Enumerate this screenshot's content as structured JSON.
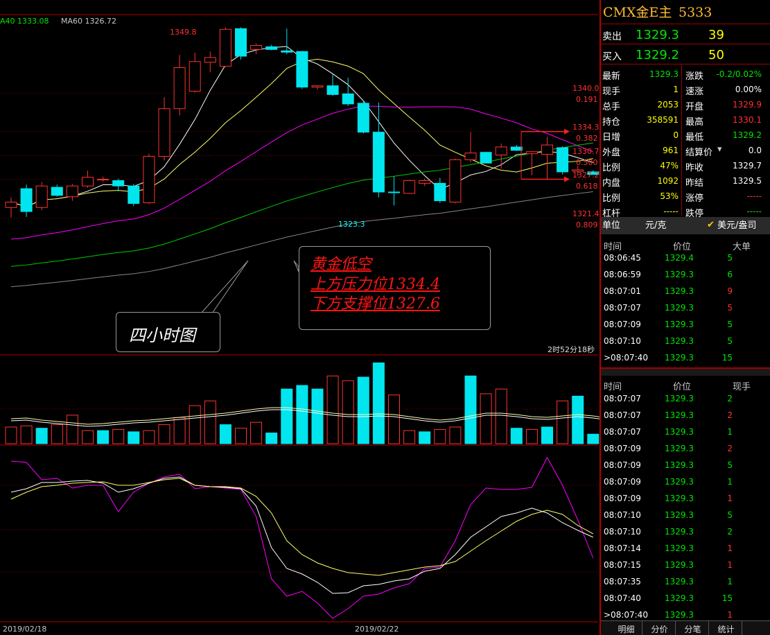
{
  "ma_legend": {
    "ma40": "A40 1333.08",
    "ma60": "MA60 1326.72"
  },
  "price_labels": {
    "high": "1349.8",
    "low": "1323.3",
    "levels": [
      {
        "price": "1340.0",
        "ratio": "0.191",
        "value": 1340.0
      },
      {
        "price": "1334.3",
        "ratio": "0.382",
        "value": 1334.3
      },
      {
        "price": "1330.7",
        "ratio": "0.500",
        "value": 1330.7
      },
      {
        "price": "1327.2",
        "ratio": "0.618",
        "value": 1327.2
      },
      {
        "price": "1321.4",
        "ratio": "0.809",
        "value": 1321.4
      }
    ]
  },
  "annotation": {
    "title": "黄金低空",
    "line1": "上方压力位1334.4",
    "line2": "下方支撑位1327.6"
  },
  "callout": "四小时图",
  "countdown": "2时52分18秒",
  "dates": [
    "2019/02/18",
    "2019/02/22"
  ],
  "colors": {
    "up": "#ff3232",
    "down": "#00e5ee",
    "grid": "#8b0000",
    "accent_red": "#b40000"
  },
  "chart_data": {
    "type": "candlestick",
    "ohlc": [
      {
        "o": 1323.0,
        "h": 1324.5,
        "l": 1321.5,
        "c": 1323.8
      },
      {
        "o": 1325.8,
        "h": 1326.4,
        "l": 1321.6,
        "c": 1322.4
      },
      {
        "o": 1323.0,
        "h": 1326.8,
        "l": 1322.6,
        "c": 1326.2
      },
      {
        "o": 1326.0,
        "h": 1326.4,
        "l": 1324.6,
        "c": 1324.8
      },
      {
        "o": 1324.6,
        "h": 1326.5,
        "l": 1324.0,
        "c": 1326.2
      },
      {
        "o": 1326.2,
        "h": 1328.5,
        "l": 1325.9,
        "c": 1327.5
      },
      {
        "o": 1327.1,
        "h": 1327.6,
        "l": 1326.8,
        "c": 1327.2
      },
      {
        "o": 1327.0,
        "h": 1327.3,
        "l": 1325.4,
        "c": 1326.2
      },
      {
        "o": 1326.2,
        "h": 1326.5,
        "l": 1323.2,
        "c": 1323.6
      },
      {
        "o": 1323.7,
        "h": 1331.0,
        "l": 1323.5,
        "c": 1330.6
      },
      {
        "o": 1330.6,
        "h": 1339.4,
        "l": 1330.0,
        "c": 1337.7
      },
      {
        "o": 1337.7,
        "h": 1345.7,
        "l": 1336.7,
        "c": 1343.8
      },
      {
        "o": 1340.3,
        "h": 1346.0,
        "l": 1340.1,
        "c": 1344.7
      },
      {
        "o": 1344.6,
        "h": 1346.2,
        "l": 1343.1,
        "c": 1345.3
      },
      {
        "o": 1344.0,
        "h": 1349.8,
        "l": 1343.9,
        "c": 1349.5
      },
      {
        "o": 1349.6,
        "h": 1349.8,
        "l": 1345.0,
        "c": 1345.5
      },
      {
        "o": 1346.5,
        "h": 1347.4,
        "l": 1345.8,
        "c": 1347.1
      },
      {
        "o": 1346.9,
        "h": 1347.2,
        "l": 1346.4,
        "c": 1346.5
      },
      {
        "o": 1346.3,
        "h": 1349.6,
        "l": 1345.8,
        "c": 1346.1
      },
      {
        "o": 1346.2,
        "h": 1346.3,
        "l": 1340.6,
        "c": 1340.9
      },
      {
        "o": 1340.9,
        "h": 1341.2,
        "l": 1340.5,
        "c": 1341.1
      },
      {
        "o": 1341.1,
        "h": 1342.8,
        "l": 1339.6,
        "c": 1339.8
      },
      {
        "o": 1339.9,
        "h": 1342.3,
        "l": 1338.1,
        "c": 1338.4
      },
      {
        "o": 1338.5,
        "h": 1338.9,
        "l": 1334.0,
        "c": 1334.2
      },
      {
        "o": 1334.2,
        "h": 1338.6,
        "l": 1324.5,
        "c": 1325.3
      },
      {
        "o": 1325.3,
        "h": 1327.6,
        "l": 1323.3,
        "c": 1325.2
      },
      {
        "o": 1325.1,
        "h": 1327.1,
        "l": 1325.0,
        "c": 1327.0
      },
      {
        "o": 1326.6,
        "h": 1327.3,
        "l": 1326.2,
        "c": 1327.0
      },
      {
        "o": 1326.6,
        "h": 1327.4,
        "l": 1323.7,
        "c": 1324.0
      },
      {
        "o": 1323.8,
        "h": 1330.3,
        "l": 1323.6,
        "c": 1330.1
      },
      {
        "o": 1330.1,
        "h": 1334.2,
        "l": 1329.7,
        "c": 1331.1
      },
      {
        "o": 1331.2,
        "h": 1331.3,
        "l": 1329.6,
        "c": 1329.6
      },
      {
        "o": 1330.8,
        "h": 1332.5,
        "l": 1328.8,
        "c": 1332.0
      },
      {
        "o": 1332.0,
        "h": 1332.3,
        "l": 1331.4,
        "c": 1331.5
      },
      {
        "o": 1331.0,
        "h": 1331.4,
        "l": 1327.8,
        "c": 1331.3
      },
      {
        "o": 1330.9,
        "h": 1333.5,
        "l": 1327.2,
        "c": 1332.3
      },
      {
        "o": 1331.9,
        "h": 1332.1,
        "l": 1327.9,
        "c": 1328.3
      },
      {
        "o": 1328.4,
        "h": 1329.2,
        "l": 1327.7,
        "c": 1328.6
      },
      {
        "o": 1328.3,
        "h": 1328.5,
        "l": 1327.9,
        "c": 1327.9
      }
    ],
    "volume": [
      14,
      15,
      13,
      16,
      24,
      11,
      11,
      12,
      10,
      11,
      16,
      22,
      32,
      36,
      16,
      13,
      18,
      9,
      46,
      49,
      46,
      57,
      53,
      56,
      68,
      41,
      11,
      10,
      12,
      14,
      57,
      42,
      46,
      13,
      12,
      14,
      36,
      40,
      8,
      3
    ],
    "volume_up": [
      true,
      true,
      false,
      true,
      true,
      true,
      false,
      true,
      false,
      true,
      true,
      true,
      true,
      true,
      false,
      true,
      true,
      false,
      false,
      false,
      false,
      true,
      true,
      false,
      false,
      true,
      true,
      false,
      true,
      true,
      false,
      true,
      true,
      false,
      true,
      false,
      true,
      false,
      false,
      false
    ]
  },
  "panel": {
    "title": "CMX金E主",
    "code": "5333",
    "sell_label": "卖出",
    "sell_price": "1329.3",
    "sell_qty": "39",
    "buy_label": "买入",
    "buy_price": "1329.2",
    "buy_qty": "50",
    "quotes": [
      {
        "l1": "最新",
        "v1": "1329.3",
        "c1": "green",
        "l2": "涨跌",
        "v2": "-0.2/0.02%",
        "c2": "green"
      },
      {
        "l1": "现手",
        "v1": "1",
        "c1": "yellow",
        "l2": "速涨",
        "v2": "0.00%",
        "c2": "white"
      },
      {
        "l1": "总手",
        "v1": "2053",
        "c1": "yellow",
        "l2": "开盘",
        "v2": "1329.9",
        "c2": "red"
      },
      {
        "l1": "持仓",
        "v1": "358591",
        "c1": "yellow",
        "l2": "最高",
        "v2": "1330.1",
        "c2": "red"
      },
      {
        "l1": "日增",
        "v1": "0",
        "c1": "yellow",
        "l2": "最低",
        "v2": "1329.2",
        "c2": "green"
      },
      {
        "l1": "外盘",
        "v1": "961",
        "c1": "yellow",
        "l2": "结算价",
        "v2": "0.0",
        "c2": "white"
      },
      {
        "l1": "比例",
        "v1": "47%",
        "c1": "yellow",
        "l2": "昨收",
        "v2": "1329.7",
        "c2": "white"
      },
      {
        "l1": "内盘",
        "v1": "1092",
        "c1": "yellow",
        "l2": "昨结",
        "v2": "1329.5",
        "c2": "white"
      },
      {
        "l1": "比例",
        "v1": "53%",
        "c1": "yellow",
        "l2": "涨停",
        "v2": "-----",
        "c2": "red"
      },
      {
        "l1": "杠杆",
        "v1": "-----",
        "c1": "yellow",
        "l2": "跌停",
        "v2": "-----",
        "c2": "green"
      }
    ],
    "unit_label": "单位",
    "unit_value": "元/克",
    "unit_option": "美元/盎司",
    "big_header": {
      "time": "时间",
      "price": "价位",
      "qty": "大单"
    },
    "big_orders": [
      {
        "time": "08:06:45",
        "price": "1329.4",
        "qty": "5",
        "qc": "green"
      },
      {
        "time": "08:06:59",
        "price": "1329.3",
        "qty": "6",
        "qc": "green"
      },
      {
        "time": "08:07:01",
        "price": "1329.3",
        "qty": "9",
        "qc": "red"
      },
      {
        "time": "08:07:07",
        "price": "1329.3",
        "qty": "5",
        "qc": "red"
      },
      {
        "time": "08:07:09",
        "price": "1329.3",
        "qty": "5",
        "qc": "green"
      },
      {
        "time": "08:07:10",
        "price": "1329.3",
        "qty": "5",
        "qc": "green"
      },
      {
        "time": ">08:07:40",
        "price": "1329.3",
        "qty": "15",
        "qc": "green"
      }
    ],
    "tick_header": {
      "time": "时间",
      "price": "价位",
      "qty": "现手"
    },
    "ticks": [
      {
        "time": "08:07:07",
        "price": "1329.3",
        "qty": "2",
        "qc": "green"
      },
      {
        "time": "08:07:07",
        "price": "1329.3",
        "qty": "2",
        "qc": "red"
      },
      {
        "time": "08:07:07",
        "price": "1329.3",
        "qty": "1",
        "qc": "green"
      },
      {
        "time": "08:07:09",
        "price": "1329.3",
        "qty": "2",
        "qc": "red"
      },
      {
        "time": "08:07:09",
        "price": "1329.3",
        "qty": "5",
        "qc": "green"
      },
      {
        "time": "08:07:09",
        "price": "1329.3",
        "qty": "1",
        "qc": "green"
      },
      {
        "time": "08:07:09",
        "price": "1329.3",
        "qty": "1",
        "qc": "red"
      },
      {
        "time": "08:07:10",
        "price": "1329.3",
        "qty": "5",
        "qc": "green"
      },
      {
        "time": "08:07:10",
        "price": "1329.3",
        "qty": "2",
        "qc": "green"
      },
      {
        "time": "08:07:14",
        "price": "1329.3",
        "qty": "1",
        "qc": "red"
      },
      {
        "time": "08:07:15",
        "price": "1329.3",
        "qty": "1",
        "qc": "red"
      },
      {
        "time": "08:07:35",
        "price": "1329.3",
        "qty": "1",
        "qc": "green"
      },
      {
        "time": "08:07:40",
        "price": "1329.3",
        "qty": "15",
        "qc": "green"
      },
      {
        "time": ">08:07:40",
        "price": "1329.3",
        "qty": "1",
        "qc": "red"
      }
    ],
    "tabs": [
      "明细",
      "分价",
      "分笔",
      "统计"
    ]
  }
}
